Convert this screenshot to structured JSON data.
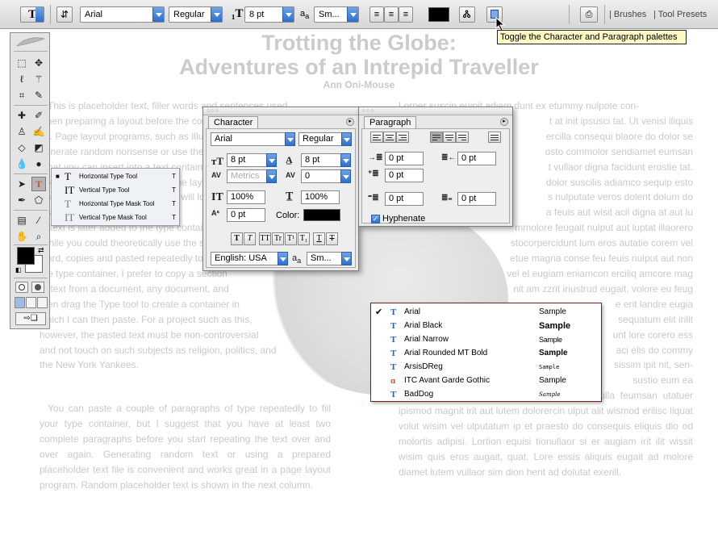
{
  "options_bar": {
    "tool_icon_label": "T",
    "font_family": "Arial",
    "font_style": "Regular",
    "font_size": "8 pt",
    "antialias": "Sm...",
    "text_color": "#000000",
    "palette_tabs": [
      "Brushes",
      "Tool Presets"
    ],
    "tooltip": "Toggle the Character and Paragraph palettes"
  },
  "document": {
    "title_line1": "Trotting the Globe:",
    "title_line2": "Adventures of an Intrepid Traveller",
    "author": "Ann Oni-Mouse",
    "left_paragraphs": [
      "This is placeholder text, filler words and sentences used\nwhen preparing a layout before the copy is available. Put\ntle.  Page layout programs, such as Illustrator, can\ngenerate random nonsense or use the same text in\nt that you can insert into a text container. The text is\nused to show the typeface and the layout design so that\nyou can visualize how the layout will look once the actual\nvisualize how the layout will look\nal text is later added to the type container.\n While you could theoretically use the same\nword, copies and pasted repeatedly to fill\nthe type container, I prefer to copy a section\nof text from a document, any document, and\nthen drag the Type tool to create a container in\nwhich I can then paste.  For a project such as this,\nhowever, the pasted text must be non-controversial\nand not touch on such subjects as religion, politics, and\nthe New York Yankees.",
      "You can paste a couple of paragraphs of type repeatedly to fill your type container, but I suggest that you have at least two complete paragraphs before you start repeating the text over and over again.  Generating random text or using a prepared placeholder text file is convenient and works great in a page layout program.  Random placeholder text is shown in the next column."
    ],
    "right_paragraphs": [
      "Lorper suscip euipit adiam dunt ex etummy nulpote con-",
      "t at init ipsusci tat. Ut venisl iliquis",
      "ercilla consequi blaore do dolor se",
      "osto commolor sendiamet eumsan",
      "t vullaor digna facidunt erostie tat.",
      "dolor suscilis adiamco sequip esto",
      "s nulputate veros dolent dolum do",
      "a feuis aut wisit acil digna at aut lu",
      "mmolore feugait nulput aut luptat illaorero",
      "stocorpercidunt lum eros autatie corem vel",
      "etue magna conse feu feuis nulput aut non",
      "vel el eugiam eniamcon erciliq amcore mag",
      "nit am zzrit iriustrud eugait, volore eu feug",
      "e erit landre eugia",
      "sequatum elit irilit",
      "unt lore corero ess",
      "aci elis do commy",
      "sissim ipit nit, sen-",
      "sustio eum ea",
      "feugait vercilit at. Ut nonsequam zzrilit, conulla feumsan utatuer ipismod magnit irit aut lutem dolorercin ulput alit wismod erilisc liquat volut wisim vel ulputatum ip et praesto do consequis eliquis dio od molortis adipisi. Lortion equisi tionullaor si er augiam irit ilit wissit wisim quis eros augait, quat. Lore essis aliquis eugait ad molore diamet lutem vullaor sim dion hent ad dolutat exerill."
    ]
  },
  "type_tool_flyout": [
    {
      "label": "Horizontal Type Tool",
      "key": "T",
      "selected": true
    },
    {
      "label": "Vertical Type Tool",
      "key": "T",
      "selected": false
    },
    {
      "label": "Horizontal Type Mask Tool",
      "key": "T",
      "selected": false
    },
    {
      "label": "Vertical Type Mask Tool",
      "key": "T",
      "selected": false
    }
  ],
  "character_palette": {
    "tab": "Character",
    "font_family": "Arial",
    "font_style": "Regular",
    "size": "8 pt",
    "leading": "8 pt",
    "kerning": "Metrics",
    "tracking": "0",
    "vertical_scale": "100%",
    "horizontal_scale": "100%",
    "baseline_shift": "0 pt",
    "color_label": "Color:",
    "color": "#000000",
    "style_buttons": [
      "T",
      "T",
      "TT",
      "Tr",
      "T¹",
      "T₁",
      "T",
      "T"
    ],
    "language": "English: USA",
    "antialias": "Sm..."
  },
  "paragraph_palette": {
    "tab": "Paragraph",
    "indent_left": "0 pt",
    "indent_right": "0 pt",
    "indent_first": "0 pt",
    "space_before": "0 pt",
    "space_after": "0 pt",
    "hyphenate_label": "Hyphenate",
    "hyphenate": true
  },
  "font_menu": [
    {
      "name": "Arial",
      "sample": "Sample",
      "checked": true,
      "type": "truetype"
    },
    {
      "name": "Arial Black",
      "sample": "Sample",
      "checked": false,
      "type": "truetype"
    },
    {
      "name": "Arial Narrow",
      "sample": "Sample",
      "checked": false,
      "type": "truetype"
    },
    {
      "name": "Arial Rounded MT Bold",
      "sample": "Sample",
      "checked": false,
      "type": "truetype"
    },
    {
      "name": "ArsisDReg",
      "sample": "Sample",
      "checked": false,
      "type": "truetype"
    },
    {
      "name": "ITC Avant Garde Gothic",
      "sample": "Sample",
      "checked": false,
      "type": "opentype"
    },
    {
      "name": "BadDog",
      "sample": "Sample",
      "checked": false,
      "type": "truetype"
    }
  ]
}
